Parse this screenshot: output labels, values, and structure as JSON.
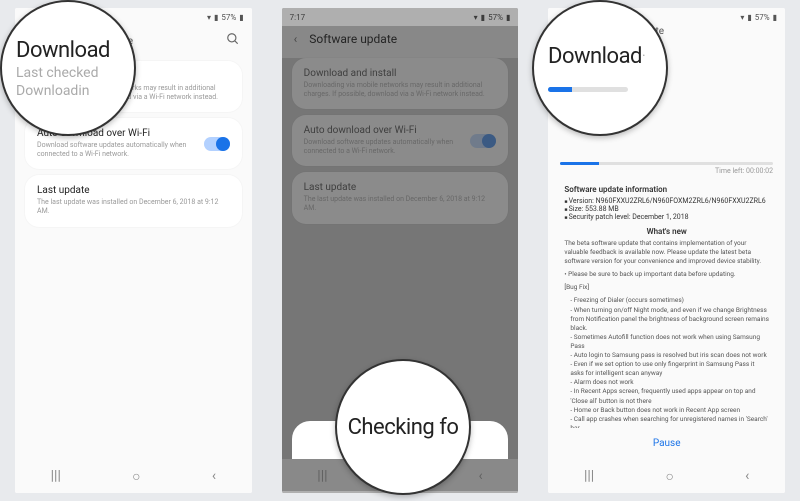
{
  "status": {
    "time": "7:17",
    "battery": "57%",
    "signal": "▲▲"
  },
  "header": {
    "title": "Software update",
    "title_partial": "ate"
  },
  "p1": {
    "download": {
      "title": "Download and install",
      "sub1": "Last checked on ...",
      "sub2": "Downloading via mobile networks may result in additional charges. If possible, download via a Wi-Fi network instead."
    },
    "auto": {
      "title": "Auto download over Wi-Fi",
      "sub": "Download software updates automatically when connected to a Wi-Fi network."
    },
    "last": {
      "title": "Last update",
      "sub": "The last update was installed on December 6, 2018 at 9:12 AM."
    }
  },
  "p2": {
    "checking": "Checking for updates"
  },
  "p3": {
    "time_left": "Time left: 00:00:02",
    "info_heading": "Software update information",
    "version_label": "Version: N960FXXU2ZRL6/N960FOXM2ZRL6/N960FXXU2ZRL6",
    "size_label": "Size: 553.88 MB",
    "patch_label": "Security patch level: December 1, 2018",
    "whats_new": "What's new",
    "intro": "The beta software update that contains implementation of your valuable feedback is available now. Please update the latest beta software version for your convenience and improved device stability.",
    "backup": "Please be sure to back up important data before updating.",
    "bugfix_heading": "[Bug Fix]",
    "bugs": [
      "Freezing of Dialer (occurs sometimes)",
      "When turning on/off Night mode, and even if we change Brightness from Notification panel the brightness of background screen remains black.",
      "Sometimes Autofill function does not work when using Samsung Pass",
      "Auto login to Samsung pass is resolved but iris scan does not work",
      "Even if we set option to use only fingerprint in Samsung Pass it asks for intelligent scan anyway",
      "Alarm does not work",
      "In Recent Apps screen, frequently used apps appear on top and 'Close all' button is not there",
      "Home or Back button does not work in Recent App screen",
      "Call app crashes when searching for unregistered names in 'Search' bar"
    ],
    "pause": "Pause"
  },
  "mag": {
    "m1_line1": "Download",
    "m1_line2": "Last checked",
    "m1_line3": "Downloadin",
    "m2": "Checking fo",
    "m3": "Download"
  }
}
